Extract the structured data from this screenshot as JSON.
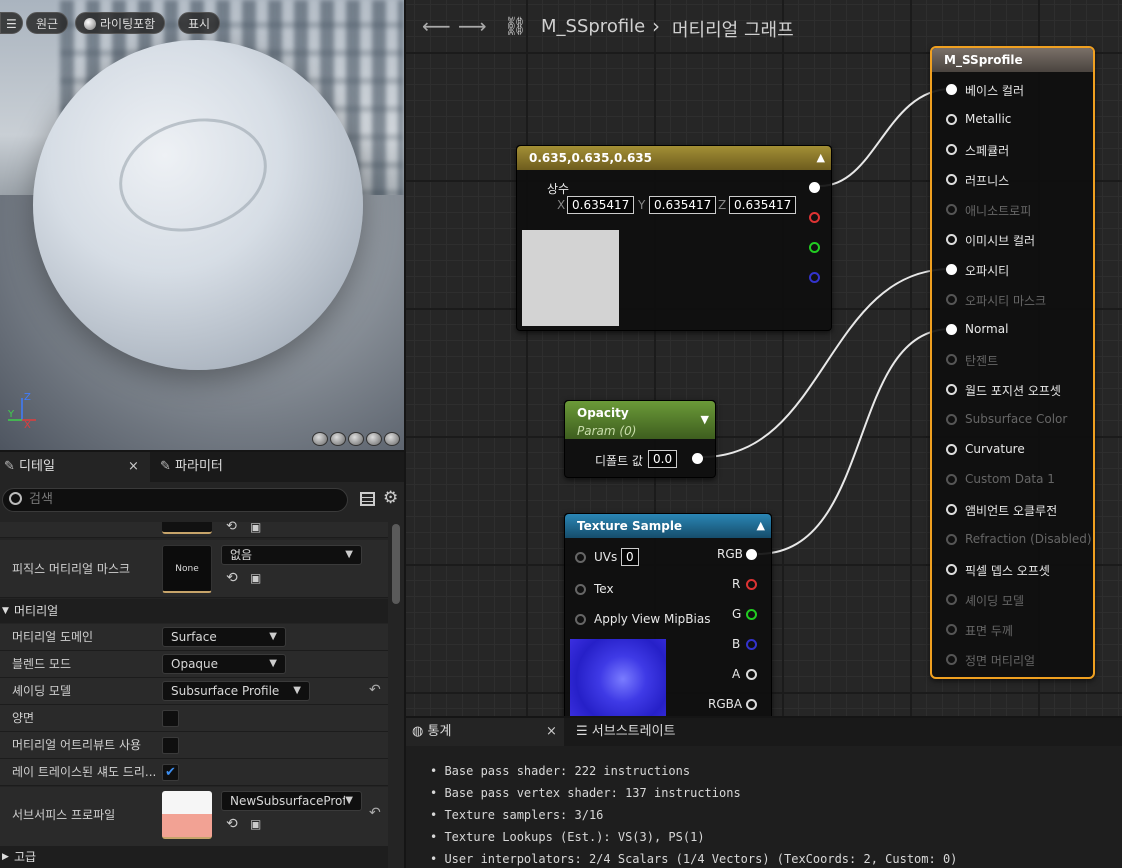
{
  "viewport": {
    "buttons": {
      "menu": "☰",
      "perspective": "원근",
      "lit": "라이팅포함",
      "show": "표시"
    },
    "axes": {
      "z": "Z",
      "y": "Y",
      "x": "X"
    }
  },
  "details": {
    "tabs": [
      {
        "label": "디테일"
      },
      {
        "label": "파라미터"
      }
    ],
    "close": "×",
    "search_placeholder": "검색",
    "physical_mask": {
      "label": "피직스 머티리얼 마스크",
      "value": "없음",
      "thumb": "None"
    },
    "section_material": "머티리얼",
    "rows": [
      {
        "label": "머티리얼 도메인",
        "value": "Surface"
      },
      {
        "label": "블렌드 모드",
        "value": "Opaque"
      },
      {
        "label": "셰이딩 모델",
        "value": "Subsurface Profile"
      },
      {
        "label": "양면"
      },
      {
        "label": "머티리얼 어트리뷰트 사용"
      },
      {
        "label": "레이 트레이스된 섀도 드리..."
      }
    ],
    "subsurface": {
      "label": "서브서피스 프로파일",
      "value": "NewSubsurfaceProfil"
    },
    "section_advanced": "고급",
    "checked_mark": "✔",
    "reset": "↶"
  },
  "graph": {
    "breadcrumb": {
      "asset": "M_SSprofile",
      "separator": "›",
      "page": "머티리얼 그래프"
    },
    "constant_node": {
      "title": "0.635,0.635,0.635",
      "label": "상수",
      "x_label": "X",
      "x": "0.635417",
      "y_label": "Y",
      "y": "0.635417",
      "z_label": "Z",
      "z": "0.635417"
    },
    "opacity_node": {
      "title": "Opacity",
      "subtitle": "Param (0)",
      "label": "디폴트 값",
      "value": "0.0"
    },
    "texture_node": {
      "title": "Texture Sample",
      "inputs": [
        {
          "label": "UVs",
          "value": "0"
        },
        {
          "label": "Tex"
        },
        {
          "label": "Apply View MipBias"
        }
      ],
      "outputs": [
        "RGB",
        "R",
        "G",
        "B",
        "A",
        "RGBA"
      ]
    },
    "result_node": {
      "title": "M_SSprofile",
      "pins": [
        {
          "label": "베이스 컬러",
          "active": true
        },
        {
          "label": "Metallic",
          "active": true
        },
        {
          "label": "스페큘러",
          "active": true
        },
        {
          "label": "러프니스",
          "active": true
        },
        {
          "label": "애니소트로피",
          "active": false
        },
        {
          "label": "이미시브 컬러",
          "active": true
        },
        {
          "label": "오파시티",
          "active": true
        },
        {
          "label": "오파시티 마스크",
          "active": false
        },
        {
          "label": "Normal",
          "active": true
        },
        {
          "label": "탄젠트",
          "active": false
        },
        {
          "label": "월드 포지션 오프셋",
          "active": true
        },
        {
          "label": "Subsurface Color",
          "active": false
        },
        {
          "label": "Curvature",
          "active": true
        },
        {
          "label": "Custom Data 1",
          "active": false
        },
        {
          "label": "앰비언트 오클루전",
          "active": true
        },
        {
          "label": "Refraction (Disabled)",
          "active": false
        },
        {
          "label": "픽셀 뎁스 오프셋",
          "active": true
        },
        {
          "label": "셰이딩 모델",
          "active": false
        },
        {
          "label": "표면 두께",
          "active": false
        },
        {
          "label": "정면 머티리얼",
          "active": false
        }
      ]
    }
  },
  "stats": {
    "tabs": [
      {
        "label": "통계"
      },
      {
        "label": "서브스트레이트"
      }
    ],
    "close": "×",
    "lines": [
      "Base pass shader: 222 instructions",
      "Base pass vertex shader: 137 instructions",
      "Texture samplers: 3/16",
      "Texture Lookups (Est.): VS(3), PS(1)",
      "User interpolators: 2/4 Scalars (1/4 Vectors) (TexCoords: 2, Custom: 0)"
    ]
  },
  "colors": {
    "accent": "#3c8ef0",
    "selection": "#f0a020",
    "constant_head": "#8a7a30",
    "opacity_head": "#5d8a2e",
    "texture_head": "#1f6d96"
  }
}
